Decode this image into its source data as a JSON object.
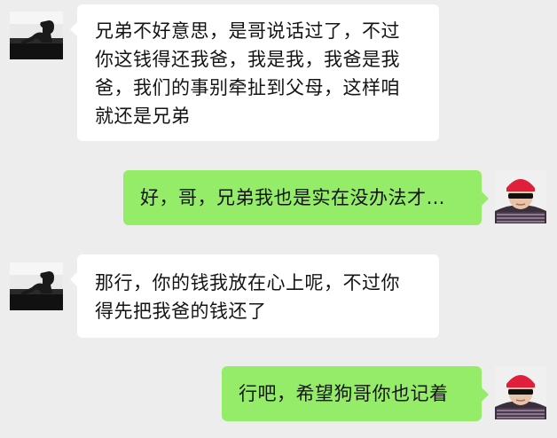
{
  "chat": {
    "contact_avatar": "silhouette-sitting-window",
    "my_avatar": "man-red-beanie-sunglasses",
    "colors": {
      "background": "#ededed",
      "received_bubble": "#ffffff",
      "sent_bubble": "#95ec69",
      "text": "#141414"
    },
    "messages": [
      {
        "side": "left",
        "text": "兄弟不好意思，是哥说话过了，不过\n你这钱得还我爸，我是我，我爸是我\n爸，我们的事别牵扯到父母，这样咱\n就还是兄弟"
      },
      {
        "side": "right",
        "text": "好，哥，兄弟我也是实在没办法才…"
      },
      {
        "side": "left",
        "text": "那行，你的钱我放在心上呢，不过你\n得先把我爸的钱还了"
      },
      {
        "side": "right",
        "text": "行吧，希望狗哥你也记着"
      }
    ]
  }
}
